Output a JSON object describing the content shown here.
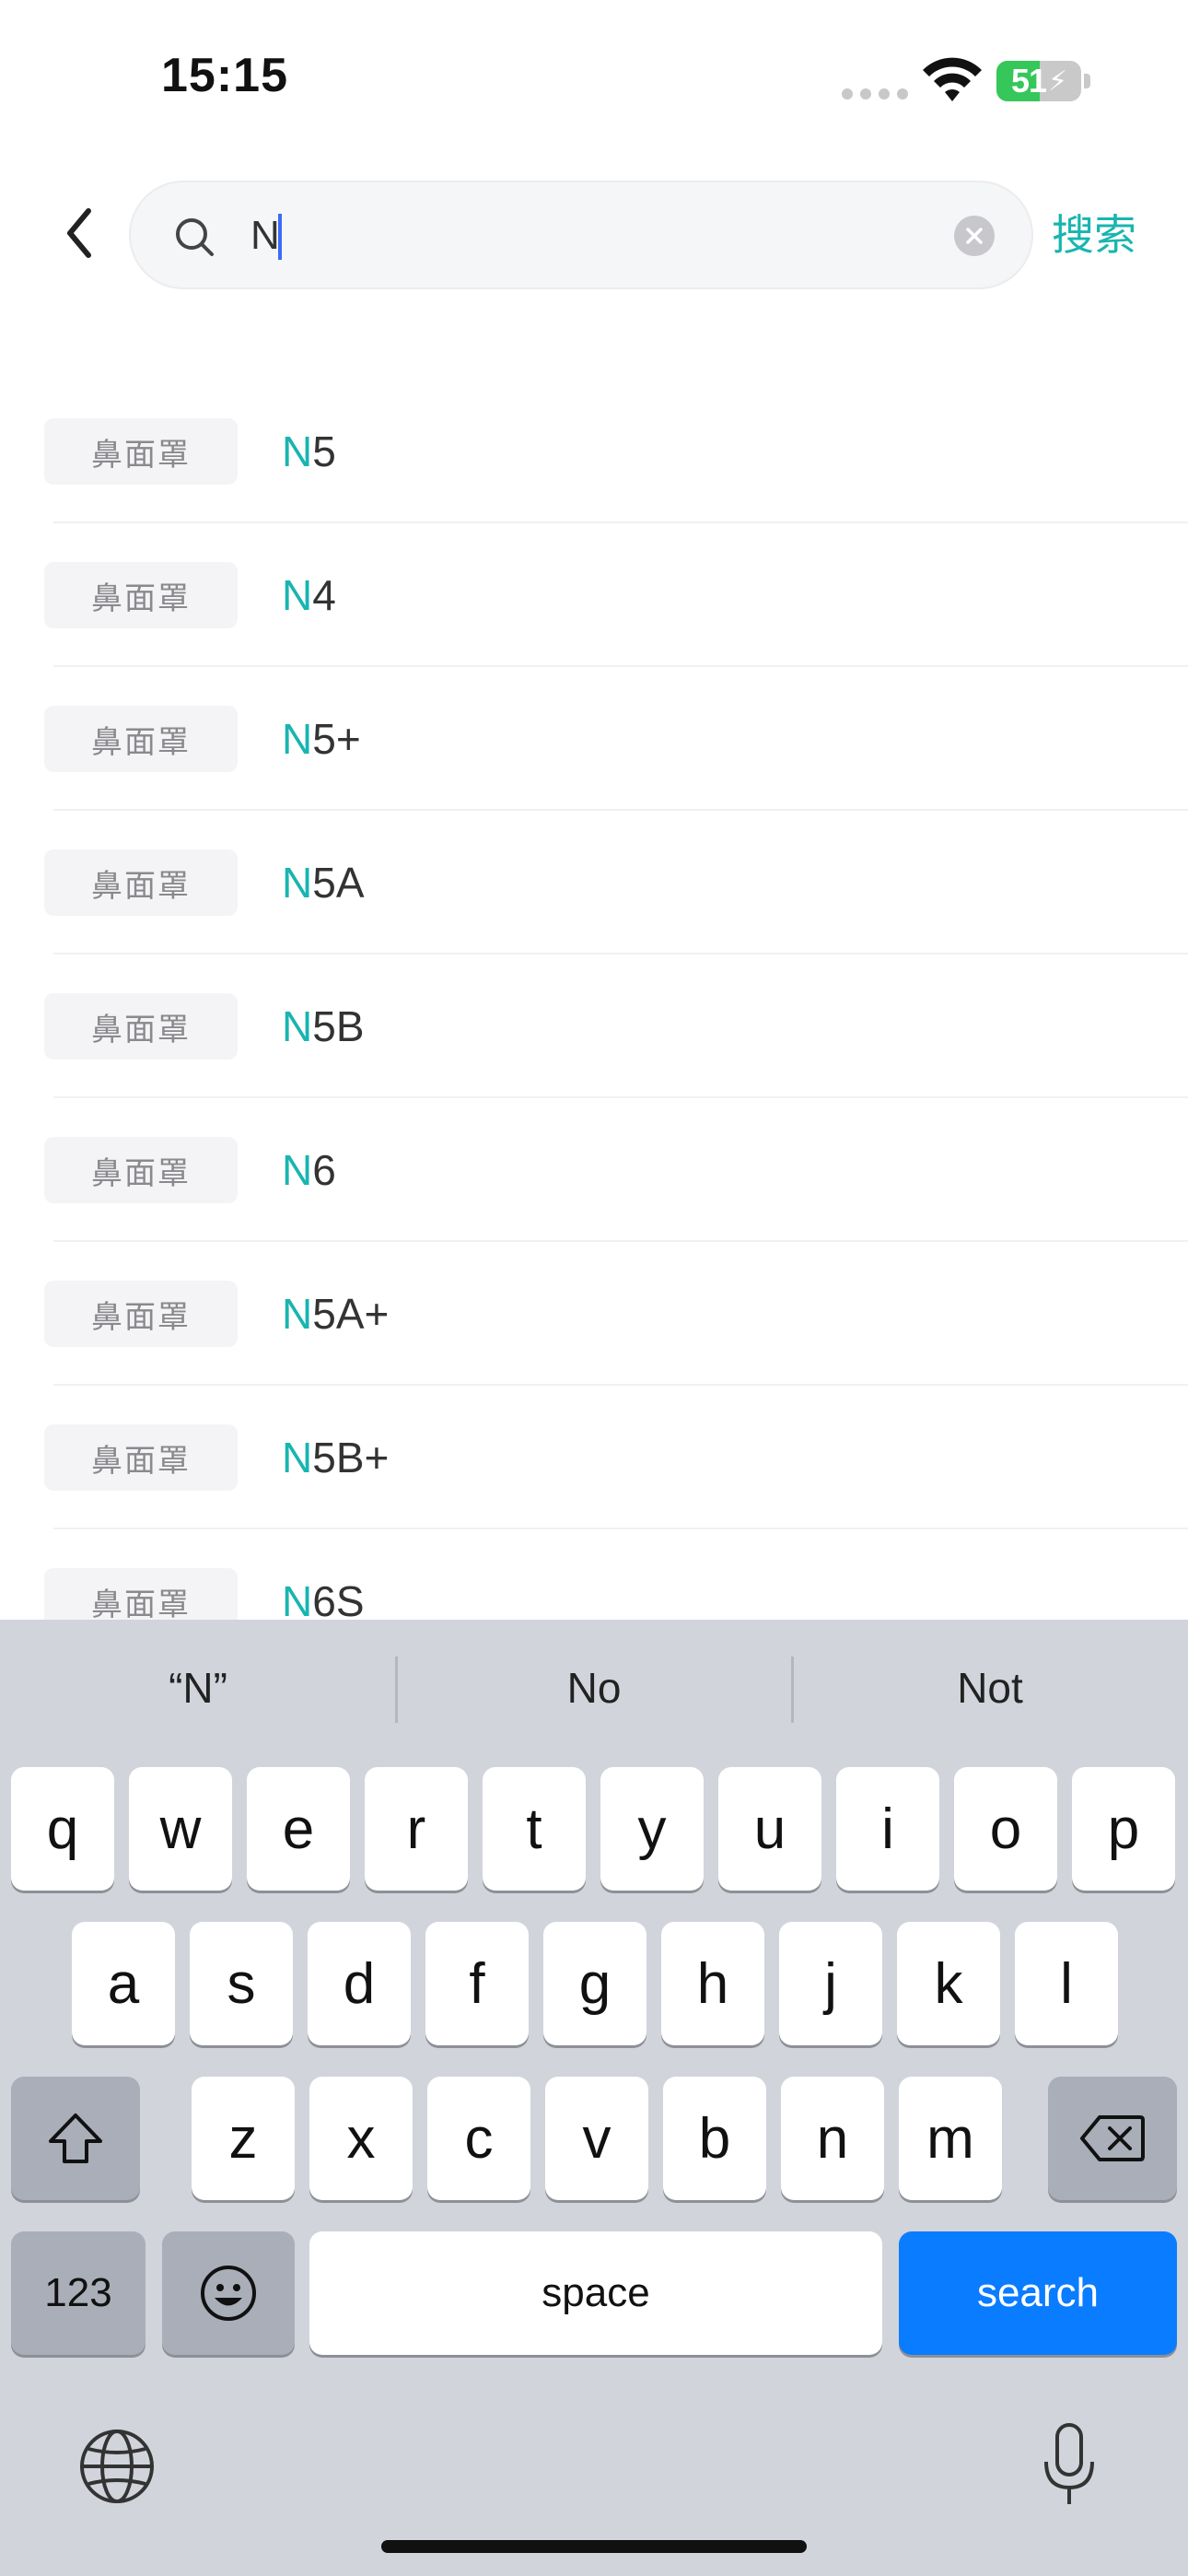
{
  "status_bar": {
    "time": "15:15",
    "battery_level": "51",
    "battery_fraction": 0.51,
    "icons": [
      "cellular-signal-icon",
      "wifi-icon",
      "battery-charging-icon"
    ]
  },
  "search": {
    "query": "N",
    "action_label": "搜索",
    "icons": {
      "back": "chevron-left-icon",
      "search": "magnifier-icon",
      "clear": "clear-circle-icon"
    }
  },
  "colors": {
    "accent": "#19b5b0",
    "caret": "#3b6cf6",
    "keyboard_bg": "#d1d4db",
    "search_key": "#0a7cff",
    "tag_bg": "#f4f4f6"
  },
  "results": [
    {
      "tag": "鼻面罩",
      "match": "N",
      "rest": "5"
    },
    {
      "tag": "鼻面罩",
      "match": "N",
      "rest": "4"
    },
    {
      "tag": "鼻面罩",
      "match": "N",
      "rest": "5+"
    },
    {
      "tag": "鼻面罩",
      "match": "N",
      "rest": "5A"
    },
    {
      "tag": "鼻面罩",
      "match": "N",
      "rest": "5B"
    },
    {
      "tag": "鼻面罩",
      "match": "N",
      "rest": "6"
    },
    {
      "tag": "鼻面罩",
      "match": "N",
      "rest": "5A+"
    },
    {
      "tag": "鼻面罩",
      "match": "N",
      "rest": "5B+"
    },
    {
      "tag": "鼻面罩",
      "match": "N",
      "rest": "6S"
    }
  ],
  "keyboard": {
    "suggestions": [
      "“N”",
      "No",
      "Not"
    ],
    "row1": [
      "q",
      "w",
      "e",
      "r",
      "t",
      "y",
      "u",
      "i",
      "o",
      "p"
    ],
    "row2": [
      "a",
      "s",
      "d",
      "f",
      "g",
      "h",
      "j",
      "k",
      "l"
    ],
    "row3": [
      "z",
      "x",
      "c",
      "v",
      "b",
      "n",
      "m"
    ],
    "numbers_label": "123",
    "space_label": "space",
    "search_label": "search",
    "icons": {
      "shift": "shift-icon",
      "delete": "backspace-icon",
      "emoji": "emoji-icon",
      "globe": "globe-icon",
      "mic": "microphone-icon"
    }
  }
}
